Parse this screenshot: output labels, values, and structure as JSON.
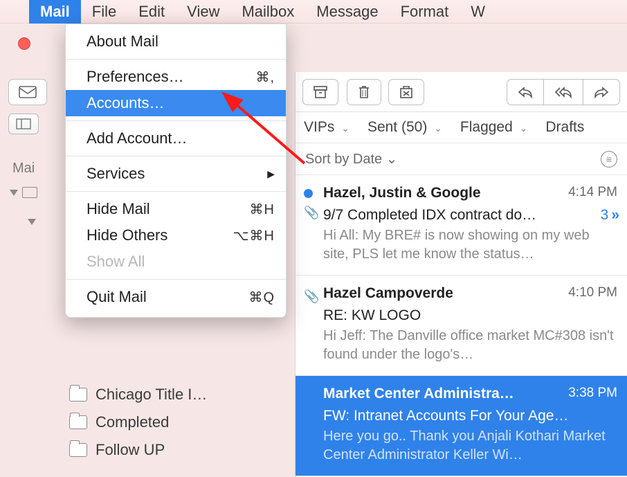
{
  "menubar": {
    "app": "Mail",
    "items": [
      "File",
      "Edit",
      "View",
      "Mailbox",
      "Message",
      "Format",
      "W"
    ]
  },
  "dropdown": {
    "about": "About Mail",
    "prefs": "Preferences…",
    "prefs_sc": "⌘,",
    "accounts": "Accounts…",
    "add_account": "Add Account…",
    "services": "Services",
    "hide_mail": "Hide Mail",
    "hide_mail_sc": "⌘H",
    "hide_others": "Hide Others",
    "hide_others_sc": "⌥⌘H",
    "show_all": "Show All",
    "quit": "Quit Mail",
    "quit_sc": "⌘Q"
  },
  "sidebar": {
    "mailboxes": "Mai",
    "folders": [
      {
        "name": "Chicago Title I…"
      },
      {
        "name": "Completed"
      },
      {
        "name": "Follow UP"
      }
    ]
  },
  "filters": {
    "vips": "VIPs",
    "sent": "Sent (50)",
    "flagged": "Flagged",
    "drafts": "Drafts",
    "sort": "Sort by Date"
  },
  "messages": [
    {
      "from": "Hazel, Justin & Google",
      "time": "4:14 PM",
      "subject": "9/7 Completed IDX contract do…",
      "thread_count": "3",
      "preview": "Hi All: My BRE# is now showing on my web site, PLS let me know the status…",
      "unread": true,
      "attachment": true
    },
    {
      "from": "Hazel Campoverde",
      "time": "4:10 PM",
      "subject": "RE: KW LOGO",
      "preview": "Hi Jeff: The Danville office market MC#308 isn't found under the logo's…",
      "attachment": true
    },
    {
      "from": "Market Center Administra…",
      "time": "3:38 PM",
      "subject": "FW: Intranet Accounts For Your Age…",
      "preview": "Here you go.. Thank you Anjali Kothari Market Center Administrator Keller Wi…",
      "selected": true
    }
  ]
}
